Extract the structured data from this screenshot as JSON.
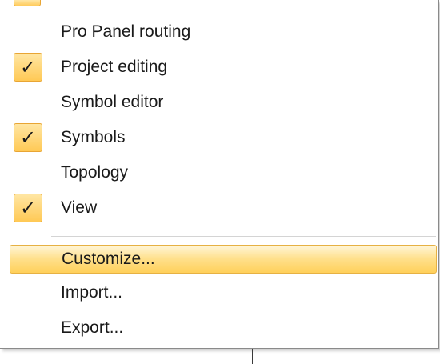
{
  "menu": {
    "items": [
      {
        "label": "Pro Panel routing",
        "checked": false
      },
      {
        "label": "Project editing",
        "checked": true
      },
      {
        "label": "Symbol editor",
        "checked": false
      },
      {
        "label": "Symbols",
        "checked": true
      },
      {
        "label": "Topology",
        "checked": false
      },
      {
        "label": "View",
        "checked": true
      }
    ],
    "actions": [
      {
        "label": "Customize...",
        "highlighted": true
      },
      {
        "label": "Import...",
        "highlighted": false
      },
      {
        "label": "Export...",
        "highlighted": false
      }
    ],
    "check_glyph": "✓",
    "highlight_color": "#ffd96e",
    "check_border_color": "#e8a534"
  }
}
